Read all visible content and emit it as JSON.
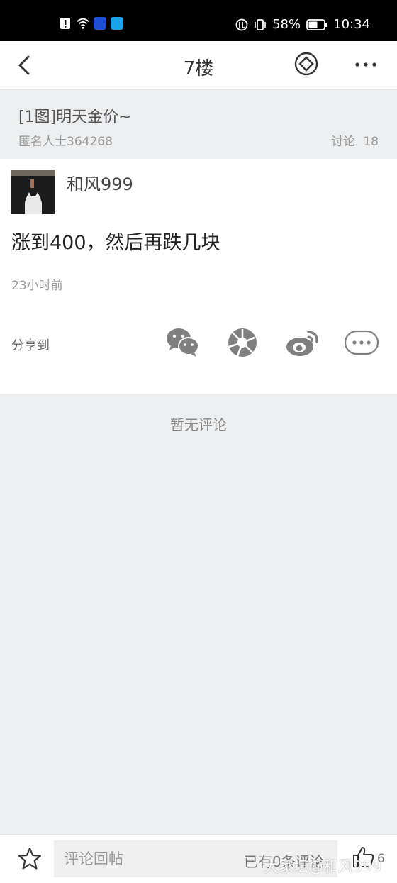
{
  "status_bar": {
    "battery": "58%",
    "time": "10:34",
    "icons": [
      "notification-icon",
      "wifi-icon",
      "bulb-app-icon",
      "search-app-icon",
      "nfc-icon",
      "vibrate-icon",
      "battery-icon"
    ]
  },
  "nav": {
    "title": "7楼",
    "icons": [
      "back-icon",
      "diamond-icon",
      "more-icon"
    ]
  },
  "thread": {
    "title": "[1图]明天金价~",
    "author": "匿名人士364268",
    "stats": "讨论 18"
  },
  "post": {
    "username": "和风999",
    "content": "涨到400，然后再跌几块",
    "time": "23小时前"
  },
  "share": {
    "label": "分享到",
    "targets": [
      "wechat-icon",
      "moments-icon",
      "weibo-icon",
      "more-share-icon"
    ]
  },
  "comments": {
    "empty_text": "暂无评论"
  },
  "bottom_bar": {
    "input_placeholder": "评论回帖",
    "comment_count": "已有0条评论",
    "like_count": "6"
  },
  "watermark": "大家坛@和风999",
  "colors": {
    "page_bg": "#eceef0",
    "card_bg": "#ffffff",
    "icon_gray": "#7f7f7f"
  }
}
